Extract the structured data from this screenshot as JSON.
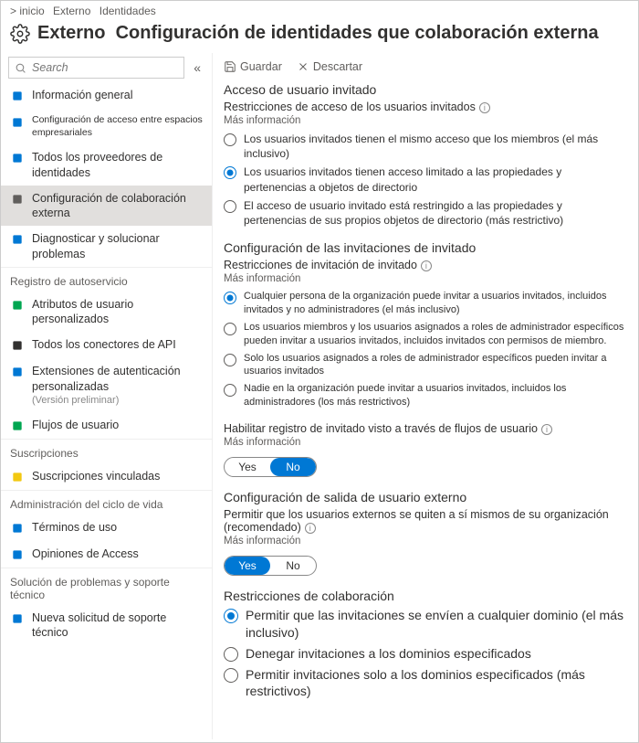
{
  "breadcrumb": {
    "home": "&gt; inicio",
    "externo": "Externo",
    "identidades": "Identidades"
  },
  "header": {
    "product": "Externo",
    "title": "Configuración de identidades que colaboración externa"
  },
  "search": {
    "placeholder": "Search"
  },
  "toolbar": {
    "save": "Guardar",
    "discard": "Descartar"
  },
  "sidebar": {
    "items_top": [
      {
        "name": "info-general",
        "label": "Información general",
        "color": "#0078d4"
      },
      {
        "name": "cross-tenant",
        "label": "Configuración de acceso entre espacios empresariales",
        "color": "#0078d4",
        "small": true
      },
      {
        "name": "providers",
        "label": "Todos los proveedores de identidades",
        "color": "#0078d4"
      },
      {
        "name": "collab-config",
        "label": "Configuración de colaboración externa",
        "color": "#605e5c",
        "selected": true
      },
      {
        "name": "diagnose",
        "label": "Diagnosticar y solucionar problemas",
        "color": "#0078d4"
      }
    ],
    "sec_self": "Registro de autoservicio",
    "items_self": [
      {
        "name": "custom-attrs",
        "label": "Atributos de usuario personalizados",
        "color": "#00a651"
      },
      {
        "name": "api-connectors",
        "label": "Todos los conectores de API",
        "color": "#323130"
      },
      {
        "name": "auth-ext",
        "label": "Extensiones de autenticación personalizadas",
        "sub": "(Versión preliminar)",
        "color": "#0078d4"
      },
      {
        "name": "user-flows",
        "label": "Flujos de usuario",
        "color": "#00a651"
      }
    ],
    "sec_subs": "Suscripciones",
    "items_subs": [
      {
        "name": "linked-subs",
        "label": "Suscripciones vinculadas",
        "color": "#f2c811"
      }
    ],
    "sec_lifecycle": "Administración del ciclo de vida",
    "items_lifecycle": [
      {
        "name": "terms",
        "label": "Términos de uso",
        "color": "#0078d4"
      },
      {
        "name": "access-reviews",
        "label": "Opiniones de Access",
        "color": "#0078d4"
      }
    ],
    "sec_support": "Solución de problemas y soporte técnico",
    "items_support": [
      {
        "name": "new-ticket",
        "label": "Nueva solicitud de soporte técnico",
        "color": "#0078d4"
      }
    ]
  },
  "guest_access": {
    "title": "Acceso de usuario invitado",
    "sub": "Restricciones de acceso de los usuarios invitados",
    "more": "Más información",
    "options": [
      "Los usuarios invitados tienen el mismo acceso que los miembros (el más inclusivo)",
      "Los usuarios invitados tienen acceso limitado a las propiedades y pertenencias a objetos de directorio",
      "El acceso de usuario invitado está restringido a las propiedades y pertenencias de sus propios objetos de directorio (más restrictivo)"
    ],
    "selected": 1
  },
  "guest_invite": {
    "title": "Configuración de las invitaciones de invitado",
    "sub": "Restricciones de invitación de invitado",
    "more": "Más información",
    "options": [
      "Cualquier persona de la organización puede invitar a usuarios invitados, incluidos invitados y no administradores (el más inclusivo)",
      "Los usuarios miembros y los usuarios asignados a roles de administrador específicos pueden invitar a usuarios invitados, incluidos invitados con permisos de miembro.",
      "Solo los usuarios asignados a roles de administrador específicos pueden invitar a usuarios invitados",
      "Nadie en la organización puede invitar a usuarios invitados, incluidos los administradores (los más restrictivos)"
    ],
    "selected": 0
  },
  "self_signup": {
    "title": "Habilitar registro de invitado visto a través de flujos de usuario",
    "more": "Más información",
    "yes": "Yes",
    "no": "No",
    "value": "No"
  },
  "leave": {
    "title": "Configuración de salida de usuario externo",
    "sub": "Permitir que los usuarios externos se quiten a sí mismos de su organización (recomendado)",
    "more": "Más información",
    "yes": "Yes",
    "no": "No",
    "value": "Yes"
  },
  "collab": {
    "title": "Restricciones de colaboración",
    "options": [
      "Permitir que las invitaciones se envíen a cualquier dominio (el más inclusivo)",
      "Denegar invitaciones a los dominios especificados",
      "Permitir invitaciones solo a los dominios especificados (más restrictivos)"
    ],
    "selected": 0
  }
}
